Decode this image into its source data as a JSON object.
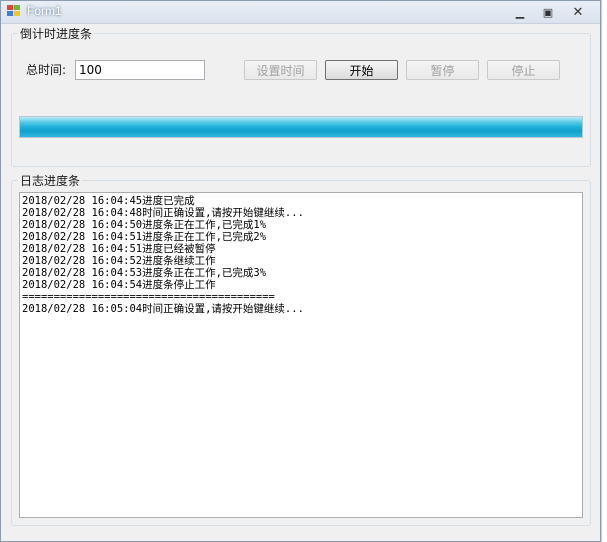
{
  "window": {
    "title": "Form1",
    "controls": {
      "minimize": "▁",
      "maximize": "▣",
      "close": "✕"
    }
  },
  "countdown_group": {
    "label": "倒计时进度条",
    "total_time_label": "总时间:",
    "total_time_value": "100",
    "buttons": {
      "set_time": "设置时间",
      "start": "开始",
      "pause": "暂停",
      "stop": "停止"
    },
    "progress_fraction": 1.0
  },
  "log_group": {
    "label": "日志进度条",
    "lines": [
      "2018/02/28 16:04:45进度已完成",
      "2018/02/28 16:04:48时间正确设置,请按开始键继续...",
      "2018/02/28 16:04:50进度条正在工作,已完成1%",
      "2018/02/28 16:04:51进度条正在工作,已完成2%",
      "2018/02/28 16:04:51进度已经被暂停",
      "2018/02/28 16:04:52进度条继续工作",
      "2018/02/28 16:04:53进度条正在工作,已完成3%",
      "2018/02/28 16:04:54进度条停止工作",
      "========================================",
      "2018/02/28 16:05:04时间正确设置,请按开始键继续..."
    ]
  },
  "colors": {
    "progress_fill": "#1fb1d8",
    "window_bg": "#f0f0f0",
    "disabled_text": "#a0a0a0"
  },
  "icons": {
    "app": "windows-form-icon"
  }
}
